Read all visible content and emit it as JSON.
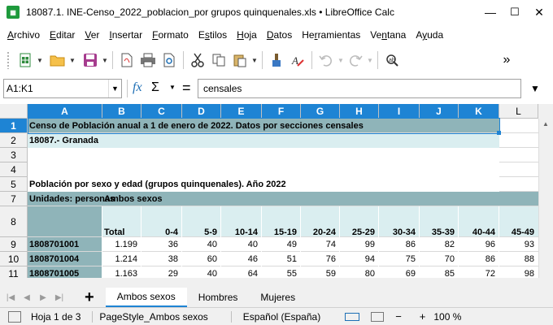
{
  "window": {
    "title": "18087.1. INE-Censo_2022_poblacion_por grupos quinquenales.xls • LibreOffice Calc",
    "minimize": "—",
    "maximize": "☐",
    "close": "✕"
  },
  "menu": [
    "Archivo",
    "Editar",
    "Ver",
    "Insertar",
    "Formato",
    "Estilos",
    "Hoja",
    "Datos",
    "Herramientas",
    "Ventana",
    "Ayuda"
  ],
  "menu_underline": [
    "A",
    "E",
    "V",
    "I",
    "F",
    "s",
    "H",
    "D",
    "r",
    "n",
    "y"
  ],
  "toolbar": {
    "icons": [
      "new-spreadsheet-icon",
      "open-folder-icon",
      "save-icon",
      "export-pdf-icon",
      "print-icon",
      "print-preview-icon",
      "cut-icon",
      "copy-icon",
      "paste-icon",
      "clone-formatting-icon",
      "clear-formatting-icon",
      "undo-icon",
      "redo-icon",
      "find-replace-icon"
    ],
    "more": "»"
  },
  "formula_bar": {
    "name_box": "A1:K1",
    "fx": "fx",
    "sigma": "Σ",
    "equals": "=",
    "content": "censales"
  },
  "columns": [
    "A",
    "B",
    "C",
    "D",
    "E",
    "F",
    "G",
    "H",
    "I",
    "J",
    "K",
    "L"
  ],
  "rows": [
    "1",
    "2",
    "3",
    "4",
    "5",
    "7",
    "8",
    "9",
    "10",
    "11"
  ],
  "cells": {
    "r1": "Censo de Población anual a 1 de enero de 2022. Datos por secciones censales",
    "r2": "18087.- Granada",
    "r4": "Población por sexo y edad (grupos quinquenales). Año 2022",
    "r5": "Unidades: personas",
    "r7": "Ambos sexos",
    "r8": [
      "Total",
      "0-4",
      "5-9",
      "10-14",
      "15-19",
      "20-24",
      "25-29",
      "30-34",
      "35-39",
      "40-44",
      "45-49"
    ],
    "r9": [
      "1808701001",
      "1.199",
      "36",
      "40",
      "40",
      "49",
      "74",
      "99",
      "86",
      "82",
      "96",
      "93"
    ],
    "r10": [
      "1808701004",
      "1.214",
      "38",
      "60",
      "46",
      "51",
      "76",
      "94",
      "75",
      "70",
      "86",
      "88"
    ],
    "r11": [
      "1808701005",
      "1.163",
      "29",
      "40",
      "64",
      "55",
      "59",
      "80",
      "69",
      "85",
      "72",
      "98"
    ]
  },
  "sheet_tabs": [
    "Ambos sexos",
    "Hombres",
    "Mujeres"
  ],
  "active_tab": 0,
  "add_tab": "+",
  "status": {
    "sheet": "Hoja 1 de 3",
    "page_style": "PageStyle_Ambos sexos",
    "language": "Español (España)",
    "zoom": "100 %"
  },
  "colors": {
    "header_fill": "#8fb4b9",
    "light_fill": "#daeef0",
    "selection": "#1e84d4"
  }
}
